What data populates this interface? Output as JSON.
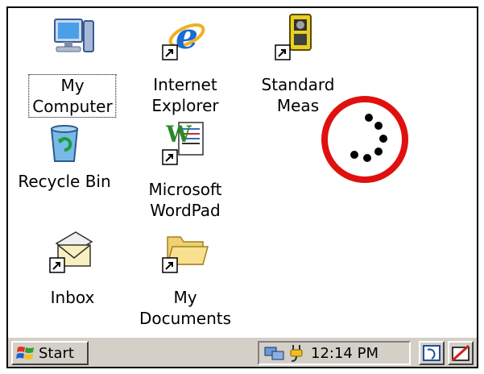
{
  "desktop": {
    "icons": [
      {
        "name": "my-computer",
        "label": "My\nComputer",
        "focused": true
      },
      {
        "name": "internet-explorer",
        "label": "Internet\nExplorer"
      },
      {
        "name": "standard-meas",
        "label": "Standard\nMeas"
      },
      {
        "name": "recycle-bin",
        "label": "Recycle Bin"
      },
      {
        "name": "microsoft-wordpad",
        "label": "Microsoft\nWordPad"
      },
      {
        "name": "inbox",
        "label": "Inbox"
      },
      {
        "name": "my-documents",
        "label": "My\nDocuments"
      }
    ]
  },
  "taskbar": {
    "start_label": "Start",
    "time": "12:14 PM"
  },
  "colors": {
    "busy_ring": "#e01010",
    "taskbar": "#d4d0c8"
  }
}
